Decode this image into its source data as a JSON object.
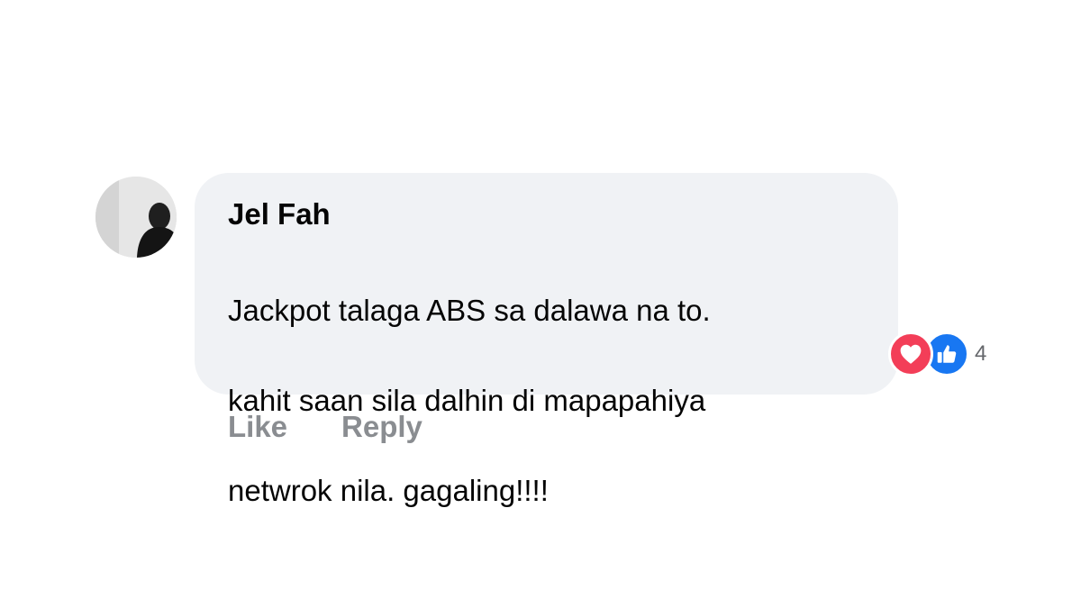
{
  "comment": {
    "author": "Jel Fah",
    "lines": [
      "Jackpot talaga ABS sa dalawa na to.",
      "kahit saan sila dalhin di mapapahiya",
      "netwrok nila. gagaling!!!!"
    ],
    "reactions": {
      "icons": [
        "heart-icon",
        "thumbs-up-icon"
      ],
      "count": "4",
      "colors": {
        "love": "#f33e58",
        "like": "#1877f2"
      }
    },
    "actions": {
      "like_label": "Like",
      "reply_label": "Reply"
    }
  },
  "colors": {
    "bubble_bg": "#f0f2f5",
    "text": "#050505",
    "muted": "#8a8d91"
  }
}
